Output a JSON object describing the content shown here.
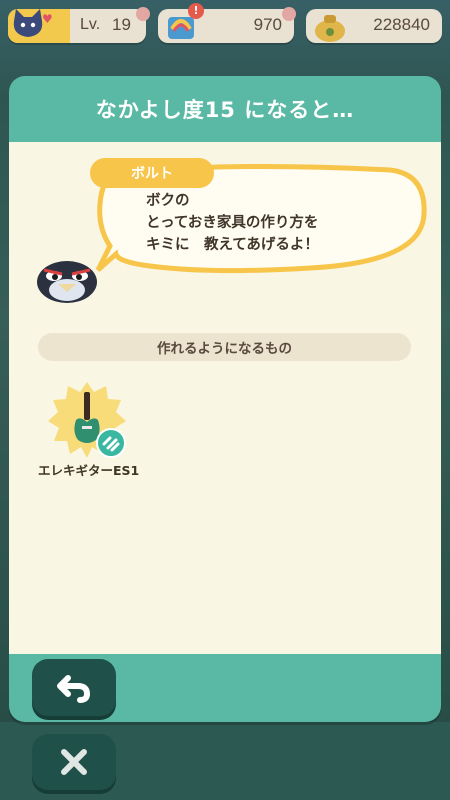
{
  "status": {
    "level_label": "Lv.",
    "level_value": "19",
    "tickets": "970",
    "bells": "228840"
  },
  "modal": {
    "title": "なかよし度15 になると…",
    "speaker": "ボルト",
    "dialogue": [
      "ボクの",
      "とっておき家具の作り方を",
      "キミに　教えてあげるよ！"
    ],
    "section_label": "作れるようになるもの",
    "item_name": "エレキギターES1"
  },
  "icons": {
    "back": "back-arrow-icon",
    "close": "close-x-icon",
    "diy": "diy-recipe-icon"
  },
  "colors": {
    "teal": "#5ab9a4",
    "cream": "#faf6e4",
    "yellow": "#f7c54a",
    "dark_button": "#1f5049"
  }
}
